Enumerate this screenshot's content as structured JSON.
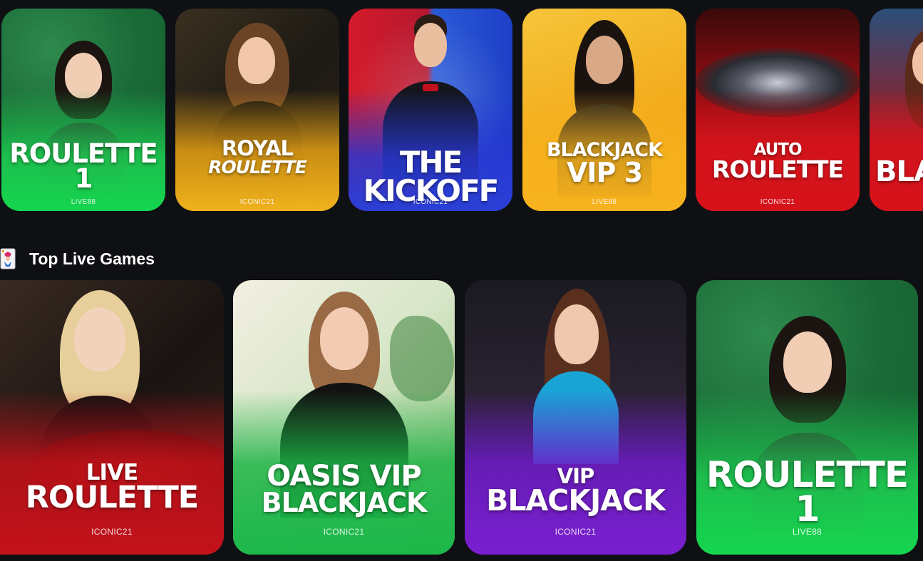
{
  "row1": {
    "cards": [
      {
        "title_line1": "ROULETTE 1",
        "title_line2": "",
        "provider": "LIVE88",
        "theme": "green"
      },
      {
        "title_line1": "ROYAL",
        "title_line2": "ROULETTE",
        "provider": "ICONIC21",
        "theme": "gold"
      },
      {
        "title_line1": "THE KICKOFF",
        "title_line2": "",
        "provider": "ICONIC21",
        "theme": "blue"
      },
      {
        "title_line1": "BLACKJACK",
        "title_line2": "VIP 3",
        "provider": "LIVE88",
        "theme": "yellow"
      },
      {
        "title_line1": "AUTO",
        "title_line2": "ROULETTE",
        "provider": "ICONIC21",
        "theme": "red"
      },
      {
        "title_line1": "BLAC",
        "title_line2": "",
        "provider": "",
        "theme": "red"
      }
    ]
  },
  "section": {
    "icon": "joker-card-icon",
    "title": "Top Live Games"
  },
  "row2": {
    "cards": [
      {
        "title_line1": "LIVE",
        "title_line2": "ROULETTE",
        "provider": "ICONIC21",
        "theme": "red"
      },
      {
        "title_line1": "OASIS VIP",
        "title_line2": "BLACKJACK",
        "provider": "ICONIC21",
        "theme": "green"
      },
      {
        "title_line1": "VIP",
        "title_line2": "BLACKJACK",
        "provider": "ICONIC21",
        "theme": "purple"
      },
      {
        "title_line1": "ROULETTE 1",
        "title_line2": "",
        "provider": "LIVE88",
        "theme": "green"
      }
    ]
  },
  "colors": {
    "page_bg": "#0f1014",
    "green": "#1fbf4a",
    "gold": "#f2a81a",
    "blue": "#2a3fd6",
    "yellow": "#f7b21d",
    "red": "#d6131b",
    "purple": "#7a1fd0"
  }
}
